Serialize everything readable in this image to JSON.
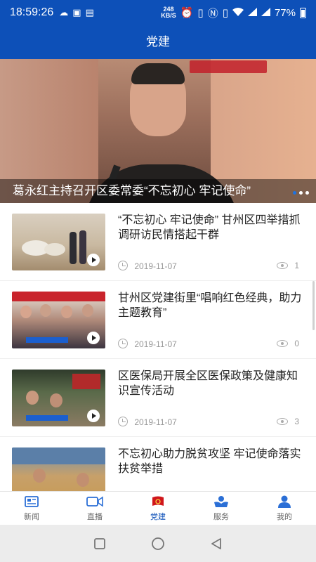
{
  "status_bar": {
    "time": "18:59:26",
    "speed_value": "248",
    "speed_unit": "KB/S",
    "battery": "77%"
  },
  "header": {
    "title": "党建"
  },
  "banner": {
    "caption": "葛永红主持召开区委常委“不忘初心 牢记使命”",
    "dots": 3,
    "active_dot": 0
  },
  "news": [
    {
      "title": "“不忘初心 牢记使命” 甘州区四举措抓调研访民情搭起干群",
      "date": "2019-11-07",
      "views": "1"
    },
    {
      "title": "甘州区党建街里“唱响红色经典，助力主题教育”",
      "date": "2019-11-07",
      "views": "0"
    },
    {
      "title": "区医保局开展全区医保政策及健康知识宣传活动",
      "date": "2019-11-07",
      "views": "3"
    },
    {
      "title": "不忘初心助力脱贫攻坚  牢记使命落实扶贫举措",
      "date": "",
      "views": ""
    }
  ],
  "tabs": [
    {
      "label": "新闻",
      "icon": "news-icon",
      "active": false
    },
    {
      "label": "直播",
      "icon": "video-icon",
      "active": false
    },
    {
      "label": "党建",
      "icon": "party-flag-icon",
      "active": true
    },
    {
      "label": "服务",
      "icon": "service-icon",
      "active": false
    },
    {
      "label": "我的",
      "icon": "user-icon",
      "active": false
    }
  ],
  "colors": {
    "primary": "#0d50b8",
    "tab_active": "#0d50b8",
    "tab_inactive": "#666666",
    "party_red": "#d0161b"
  }
}
